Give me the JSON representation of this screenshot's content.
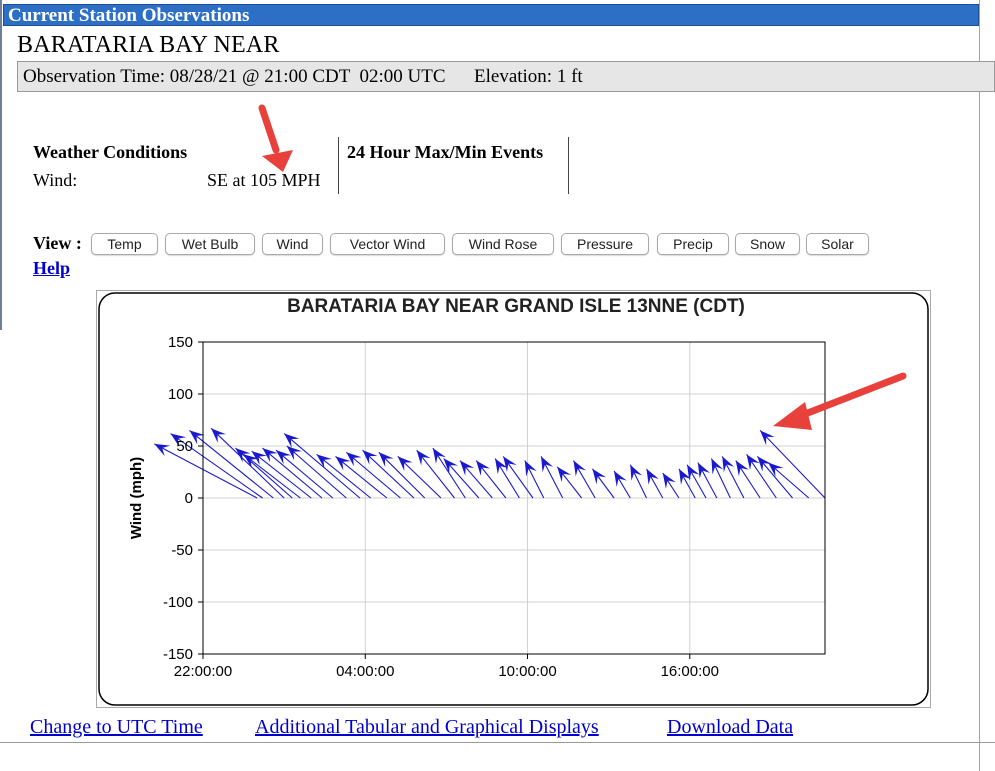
{
  "window": {
    "title": "Current Station Observations"
  },
  "station": {
    "name": "BARATARIA BAY NEAR"
  },
  "observation": {
    "text": "Observation Time: 08/28/21 @ 21:00 CDT  02:00 UTC      Elevation: 1 ft"
  },
  "conditions": {
    "title": "Weather Conditions",
    "wind_label": "Wind:",
    "wind_value": "SE at 105 MPH",
    "events_title": "24 Hour Max/Min Events"
  },
  "view": {
    "label": "View :",
    "buttons": [
      "Temp",
      "Wet Bulb",
      "Wind",
      "Vector Wind",
      "Wind Rose",
      "Pressure",
      "Precip",
      "Snow",
      "Solar"
    ]
  },
  "help": "Help",
  "links": {
    "utc": "Change to UTC Time",
    "tabular": "Additional Tabular and Graphical Displays",
    "download": "Download Data"
  },
  "colors": {
    "title_bar": "#2e6fc6",
    "link": "#0000cc",
    "vector": "#1a1acc",
    "annotation": "#e8403a"
  },
  "chart_data": {
    "type": "vector",
    "title": "BARATARIA BAY NEAR GRAND ISLE 13NNE (CDT)",
    "ylabel": "Wind (mph)",
    "xlabel": "",
    "ylim": [
      -150,
      150
    ],
    "yticks": [
      150,
      100,
      50,
      0,
      -50,
      -100,
      -150
    ],
    "xlim": [
      0,
      23
    ],
    "xticks": [
      {
        "x": 0,
        "label": "22:00:00"
      },
      {
        "x": 6,
        "label": "04:00:00"
      },
      {
        "x": 12,
        "label": "10:00:00"
      },
      {
        "x": 18,
        "label": "16:00:00"
      }
    ],
    "grid": true,
    "vectors": [
      {
        "x": 2.0,
        "tip_x": -1.8,
        "tip_y": 52
      },
      {
        "x": 2.2,
        "tip_x": -1.2,
        "tip_y": 62
      },
      {
        "x": 2.6,
        "tip_x": -0.5,
        "tip_y": 65
      },
      {
        "x": 3.0,
        "tip_x": 0.3,
        "tip_y": 67
      },
      {
        "x": 3.3,
        "tip_x": 1.2,
        "tip_y": 48
      },
      {
        "x": 3.6,
        "tip_x": 1.5,
        "tip_y": 42
      },
      {
        "x": 4.0,
        "tip_x": 1.8,
        "tip_y": 45
      },
      {
        "x": 4.4,
        "tip_x": 2.2,
        "tip_y": 48
      },
      {
        "x": 4.8,
        "tip_x": 2.7,
        "tip_y": 46
      },
      {
        "x": 5.3,
        "tip_x": 3.1,
        "tip_y": 50
      },
      {
        "x": 5.8,
        "tip_x": 3.0,
        "tip_y": 62
      },
      {
        "x": 6.2,
        "tip_x": 4.2,
        "tip_y": 42
      },
      {
        "x": 6.8,
        "tip_x": 4.9,
        "tip_y": 40
      },
      {
        "x": 7.3,
        "tip_x": 5.3,
        "tip_y": 44
      },
      {
        "x": 7.8,
        "tip_x": 5.9,
        "tip_y": 46
      },
      {
        "x": 8.2,
        "tip_x": 6.5,
        "tip_y": 44
      },
      {
        "x": 8.8,
        "tip_x": 7.2,
        "tip_y": 40
      },
      {
        "x": 9.3,
        "tip_x": 7.9,
        "tip_y": 46
      },
      {
        "x": 9.7,
        "tip_x": 8.5,
        "tip_y": 48
      },
      {
        "x": 10.2,
        "tip_x": 8.9,
        "tip_y": 38
      },
      {
        "x": 10.7,
        "tip_x": 9.5,
        "tip_y": 36
      },
      {
        "x": 11.2,
        "tip_x": 10.1,
        "tip_y": 36
      },
      {
        "x": 11.7,
        "tip_x": 10.8,
        "tip_y": 38
      },
      {
        "x": 12.2,
        "tip_x": 11.1,
        "tip_y": 40
      },
      {
        "x": 12.6,
        "tip_x": 11.9,
        "tip_y": 36
      },
      {
        "x": 13.3,
        "tip_x": 12.5,
        "tip_y": 40
      },
      {
        "x": 14.0,
        "tip_x": 13.1,
        "tip_y": 30
      },
      {
        "x": 14.5,
        "tip_x": 13.7,
        "tip_y": 36
      },
      {
        "x": 15.2,
        "tip_x": 14.4,
        "tip_y": 28
      },
      {
        "x": 15.8,
        "tip_x": 15.2,
        "tip_y": 26
      },
      {
        "x": 16.4,
        "tip_x": 15.8,
        "tip_y": 32
      },
      {
        "x": 17.0,
        "tip_x": 16.4,
        "tip_y": 28
      },
      {
        "x": 17.6,
        "tip_x": 17.0,
        "tip_y": 24
      },
      {
        "x": 18.2,
        "tip_x": 17.6,
        "tip_y": 28
      },
      {
        "x": 18.6,
        "tip_x": 17.9,
        "tip_y": 32
      },
      {
        "x": 19.0,
        "tip_x": 18.3,
        "tip_y": 34
      },
      {
        "x": 19.5,
        "tip_x": 18.8,
        "tip_y": 38
      },
      {
        "x": 20.0,
        "tip_x": 19.2,
        "tip_y": 40
      },
      {
        "x": 20.6,
        "tip_x": 19.7,
        "tip_y": 36
      },
      {
        "x": 21.2,
        "tip_x": 20.1,
        "tip_y": 42
      },
      {
        "x": 21.8,
        "tip_x": 20.5,
        "tip_y": 40
      },
      {
        "x": 22.4,
        "tip_x": 20.9,
        "tip_y": 34
      },
      {
        "x": 23.0,
        "tip_x": 20.6,
        "tip_y": 65
      }
    ]
  }
}
